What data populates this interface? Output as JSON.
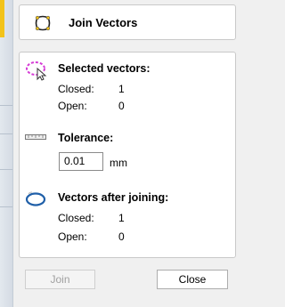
{
  "header": {
    "title": "Join Vectors",
    "icon": "join-vectors-icon"
  },
  "selected": {
    "title": "Selected vectors:",
    "icon": "selected-vectors-icon",
    "closed_label": "Closed:",
    "closed_value": "1",
    "open_label": "Open:",
    "open_value": "0"
  },
  "tolerance": {
    "title": "Tolerance:",
    "icon": "ruler-icon",
    "value": "0.01",
    "unit": "mm"
  },
  "after": {
    "title": "Vectors after joining:",
    "icon": "joined-vector-icon",
    "closed_label": "Closed:",
    "closed_value": "1",
    "open_label": "Open:",
    "open_value": "0"
  },
  "buttons": {
    "join": "Join",
    "close": "Close"
  },
  "colors": {
    "accent": "#f3c31a",
    "selection": "#d63bd6",
    "joined": "#1f5fa8"
  }
}
